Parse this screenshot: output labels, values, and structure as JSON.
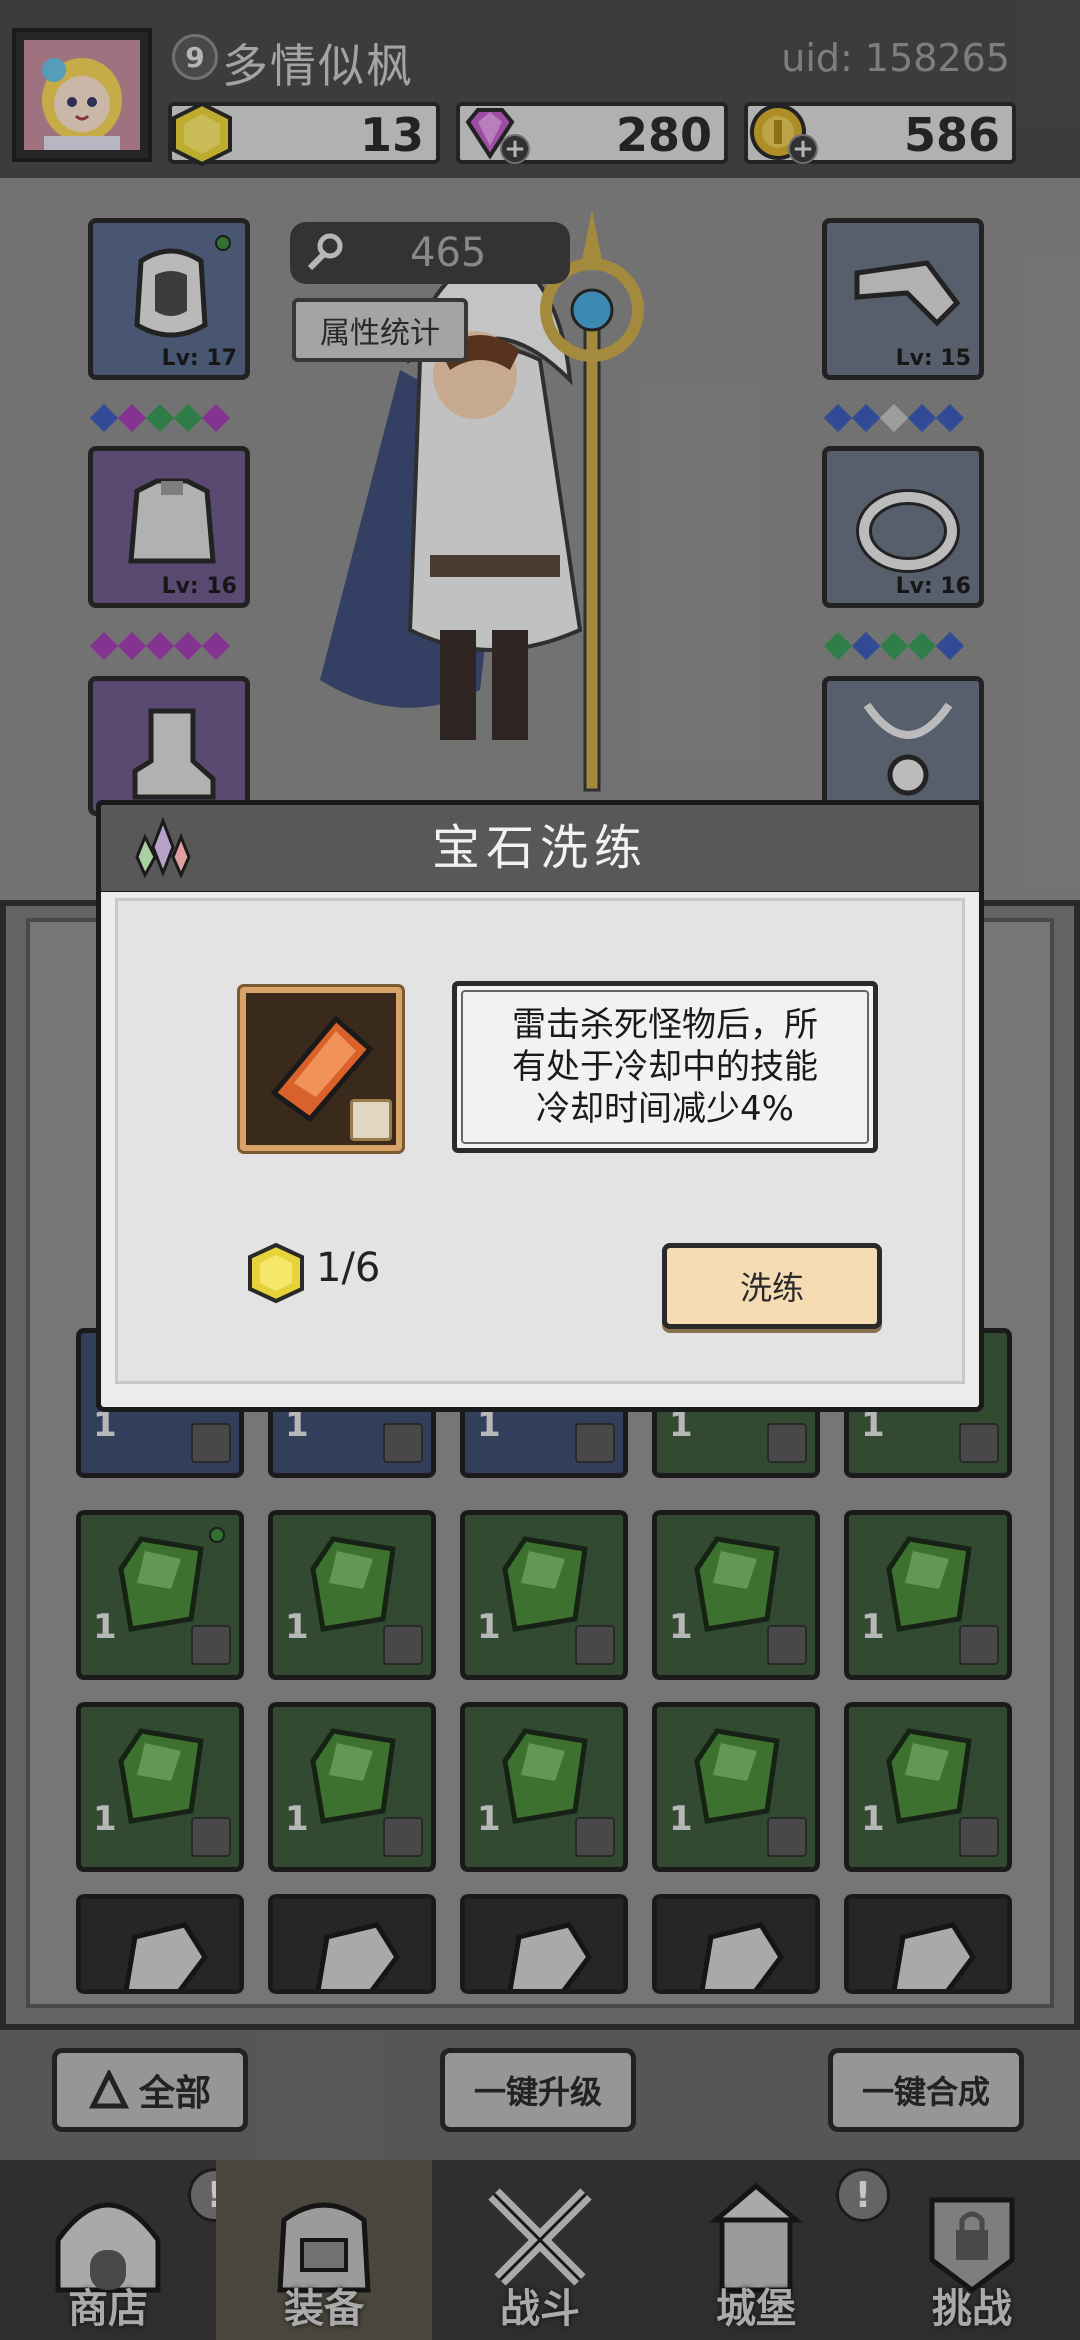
{
  "header": {
    "player_level": "9",
    "player_name": "多情似枫",
    "uid": "uid: 158265",
    "resources": [
      {
        "icon": "gold-gem-icon",
        "value": "13"
      },
      {
        "icon": "diamond-icon",
        "value": "280"
      },
      {
        "icon": "coin-icon",
        "value": "586"
      }
    ]
  },
  "equipment": {
    "power": "465",
    "attr_stats_label": "属性统计",
    "slots": [
      {
        "name": "helmet",
        "level": "Lv: 17"
      },
      {
        "name": "armor",
        "level": "Lv: 16"
      },
      {
        "name": "boots",
        "level": ""
      },
      {
        "name": "weapon",
        "level": "Lv: 15"
      },
      {
        "name": "ring",
        "level": "Lv: 16"
      },
      {
        "name": "necklace",
        "level": ""
      }
    ]
  },
  "inventory": {
    "partial_row_counts": [
      "1",
      "1",
      "1",
      "1",
      "1"
    ],
    "rows": [
      [
        "1",
        "1",
        "1",
        "1",
        "1"
      ],
      [
        "1",
        "1",
        "1",
        "1",
        "1"
      ]
    ]
  },
  "actions": {
    "filter_all": "全部",
    "upgrade_all": "一键升级",
    "merge_all": "一键合成"
  },
  "nav": {
    "items": [
      {
        "label": "商店",
        "alert": "!"
      },
      {
        "label": "装备",
        "alert": ""
      },
      {
        "label": "战斗",
        "alert": ""
      },
      {
        "label": "城堡",
        "alert": "!"
      },
      {
        "label": "挑战",
        "alert": ""
      }
    ]
  },
  "dialog": {
    "title": "宝石洗练",
    "description_line1": "雷击杀死怪物后，所",
    "description_line2": "有处于冷却中的技能",
    "description_line3": "冷却时间减少4%",
    "cost": "1/6",
    "refine_label": "洗练"
  },
  "colors": {
    "accent_orange": "#d9a36a",
    "button_cream": "#f6dcb4",
    "gem_green": "#3e5a3e"
  }
}
